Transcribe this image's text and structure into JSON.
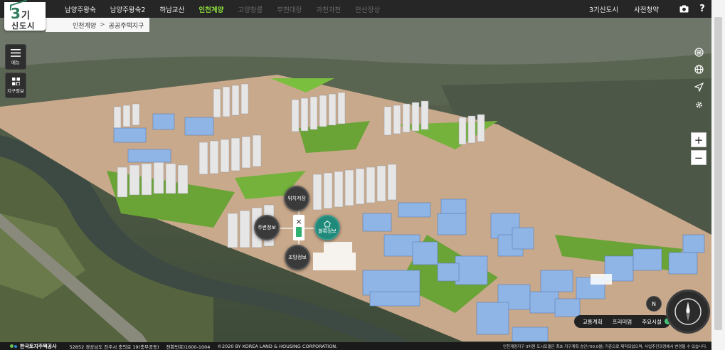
{
  "app": {
    "logo_number": "3",
    "logo_gi": "기",
    "logo_sub": "신도시"
  },
  "nav": {
    "items": [
      {
        "label": "남양주왕숙",
        "state": "normal"
      },
      {
        "label": "남양주왕숙2",
        "state": "normal"
      },
      {
        "label": "하남교산",
        "state": "normal"
      },
      {
        "label": "인천계양",
        "state": "active"
      },
      {
        "label": "고양창릉",
        "state": "dim"
      },
      {
        "label": "부천대장",
        "state": "dim"
      },
      {
        "label": "과천과천",
        "state": "dim"
      },
      {
        "label": "안산장상",
        "state": "dim"
      }
    ],
    "right_links": [
      "3기신도시",
      "사전청약"
    ],
    "camera_icon": "camera-icon",
    "help_label": "?"
  },
  "breadcrumb": {
    "parent": "인천계양",
    "separator": ">",
    "current": "공공주택지구"
  },
  "left_tools": {
    "menu_label": "메뉴",
    "district_info_label": "지구정보"
  },
  "right_tools": {
    "icons": [
      "building-icon",
      "globe-icon",
      "send-icon",
      "gear-icon"
    ],
    "zoom_in": "+",
    "zoom_out": "−"
  },
  "radial_menu": {
    "top": "위치저장",
    "left": "주변정보",
    "right": "블록정보",
    "bottom": "조망정보",
    "center_close": "×",
    "center_label": "블록"
  },
  "bottom_controls": {
    "pills": [
      "교통계획",
      "프리미엄",
      "주요시설"
    ],
    "compass_north": "N"
  },
  "footer": {
    "org": "한국토지주택공사",
    "address": "52852 경상남도 진주시 충의로 19(충무공동)",
    "phone": "전화번호)1600-1004",
    "copyright": "©2020 BY KOREA LAND & HOUSING CORPORATION.",
    "notice": "인천계양지구 3차원 도시모델은 최초 지구계획 승인('00.0월) 기준으로 제작되었으며, 사업추진과정에서 변경될 수 있습니다."
  },
  "colors": {
    "accent_green": "#8bdc3c",
    "active_block": "#1f8a7a",
    "topbar": "#262626"
  }
}
